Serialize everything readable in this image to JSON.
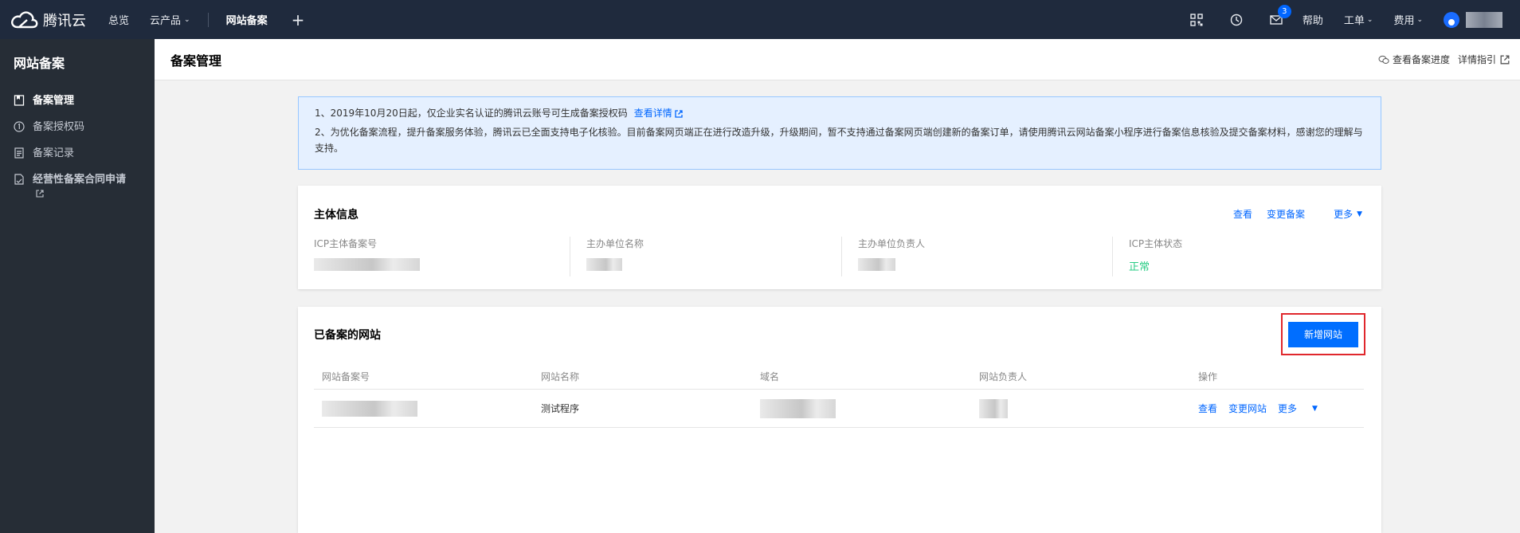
{
  "topnav": {
    "brand": "腾讯云",
    "links": [
      {
        "label": "总览"
      },
      {
        "label": "云产品",
        "caret": "⌄"
      }
    ],
    "active": "网站备案",
    "plus": "+",
    "right": {
      "badge_count": "3",
      "help": "帮助",
      "ticket": "工单",
      "billing": "费用",
      "caret": "⌄"
    }
  },
  "sidebar": {
    "title": "网站备案",
    "items": [
      {
        "label": "备案管理",
        "icon": "bookmark-icon"
      },
      {
        "label": "备案授权码",
        "icon": "number-circle-icon"
      },
      {
        "label": "备案记录",
        "icon": "document-icon"
      },
      {
        "label": "经营性备案合同申请",
        "icon": "contract-icon"
      }
    ]
  },
  "header": {
    "title": "备案管理",
    "progress_link": "查看备案进度",
    "guide_link": "详情指引"
  },
  "notice": {
    "line1": "1、2019年10月20日起，仅企业实名认证的腾讯云账号可生成备案授权码",
    "line1_link": "查看详情",
    "line2": "2、为优化备案流程，提升备案服务体验，腾讯云已全面支持电子化核验。目前备案网页端正在进行改造升级，升级期间，暂不支持通过备案网页端创建新的备案订单，请使用腾讯云网站备案小程序进行备案信息核验及提交备案材料，感谢您的理解与支持。"
  },
  "entity": {
    "title": "主体信息",
    "actions": {
      "view": "查看",
      "change": "变更备案",
      "more": "更多",
      "caret": "▼"
    },
    "fields": [
      {
        "label": "ICP主体备案号"
      },
      {
        "label": "主办单位名称"
      },
      {
        "label": "主办单位负责人"
      },
      {
        "label": "ICP主体状态",
        "value": "正常"
      }
    ]
  },
  "sites": {
    "title": "已备案的网站",
    "add_button": "新增网站",
    "columns": [
      "网站备案号",
      "网站名称",
      "域名",
      "网站负责人",
      "操作"
    ],
    "rows": [
      {
        "name": "测试程序",
        "actions": {
          "view": "查看",
          "change": "变更网站",
          "more": "更多",
          "caret": "▼"
        }
      }
    ]
  },
  "colors": {
    "topnav_bg": "#1f2a3d",
    "sidebar_bg": "#262d36",
    "accent": "#006eff",
    "link": "#0066ff",
    "status_ok": "#29cc85",
    "highlight_border": "#e0272c",
    "notice_bg": "#e5f0ff"
  }
}
